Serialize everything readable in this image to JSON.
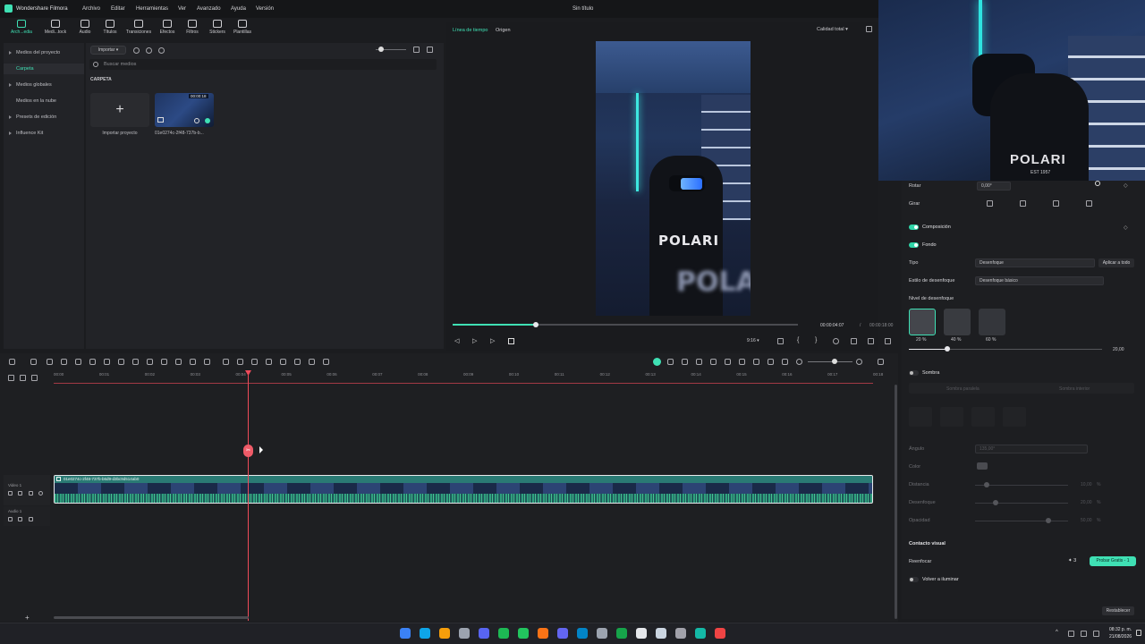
{
  "app": {
    "title": "Wondershare Filmora",
    "document_title": "Sin título"
  },
  "menu": [
    "Archivo",
    "Editar",
    "Herramientas",
    "Ver",
    "Avanzado",
    "Ayuda",
    "Versión"
  ],
  "toolbar": {
    "items": [
      {
        "label": "Arch...edia",
        "active": true
      },
      {
        "label": "Medi...tock"
      },
      {
        "label": "Audio"
      },
      {
        "label": "Títulos"
      },
      {
        "label": "Transiciones"
      },
      {
        "label": "Efectos"
      },
      {
        "label": "Filtros"
      },
      {
        "label": "Stickers"
      },
      {
        "label": "Plantillas"
      }
    ]
  },
  "sidebar": {
    "items": [
      "Medios del proyecto",
      "Carpeta",
      "Medios globales",
      "Medios en la nube",
      "Presets de edición",
      "Influence Kit"
    ]
  },
  "media": {
    "import_label": "Importar",
    "search_placeholder": "Buscar medios",
    "folder_label": "CARPETA",
    "import_project_label": "Importar proyecto",
    "clip_name": "01e0274c-2f48-737b-b...",
    "clip_duration": "00:00:18"
  },
  "preview": {
    "tab_timeline": "Línea de tiempo",
    "tab_origin": "Origen",
    "quality": "Calidad total",
    "current_time": "00:00:04:07",
    "separator": "/",
    "total_time": "00:00:18:00",
    "aspect": "9:16",
    "progress": 0.24
  },
  "properties": {
    "rotate_label": "Rotar",
    "rotate_value": "0,00°",
    "flip_label": "Girar",
    "composition_label": "Composición",
    "background_label": "Fondo",
    "type_label": "Tipo",
    "type_value": "Desenfoque",
    "apply_all": "Aplicar a todo",
    "blur_style_label": "Estilo de desenfoque",
    "blur_style_value": "Desenfoque básico",
    "blur_level_label": "Nivel de desenfoque",
    "blur_presets": [
      "20 %",
      "40 %",
      "60 %"
    ],
    "blur_value": "20,00",
    "blur_slider": 0.2,
    "shadow_label": "Sombra",
    "shadow_tab_1": "Sombra paralela",
    "shadow_tab_2": "Sombra interior",
    "angle_label": "Ángulo",
    "angle_value": "135,00°",
    "color_label": "Color",
    "distance_label": "Distancia",
    "distance_value": "10,00",
    "blur_label": "Desenfoque",
    "blur2_value": "20,00",
    "opacity_label": "Opacidad",
    "opacity_value": "50,00",
    "percent": "%",
    "visual_contact_label": "Contacto visual",
    "reinforce_label": "Reenfocar",
    "credits": "3",
    "try_free": "Probar Gratis - 1",
    "relight_label": "Volver a iluminar",
    "reset": "Restablecer"
  },
  "timeline": {
    "ruler": [
      "00:00",
      "00:01",
      "00:02",
      "00:03",
      "00:04",
      "00:05",
      "00:06",
      "00:07",
      "00:08",
      "00:09",
      "00:10",
      "00:11",
      "00:12",
      "00:13",
      "00:14",
      "00:15",
      "00:16",
      "00:17",
      "00:18"
    ],
    "video_track": "Video 1",
    "audio_track": "Audio 1",
    "clip_label": "01e0274c-2f48-737b-b6d9-d3bc9d514ab0"
  },
  "webcam": {
    "hoodie_text": "POLARI",
    "sub_text": "EST 1957"
  },
  "taskbar": {
    "time": "08:32 p. m.",
    "date": "21/08/2026",
    "colors": [
      "#3b82f6",
      "#0ea5e9",
      "#f59e0b",
      "#9ca3af",
      "#5865f2",
      "#1db954",
      "#22c55e",
      "#f97316",
      "#6366f1",
      "#0284c7",
      "#9ca3af",
      "#16a34a",
      "#e5e7eb",
      "#cbd5e1",
      "#a1a1aa",
      "#14b8a6",
      "#ef4444"
    ]
  }
}
